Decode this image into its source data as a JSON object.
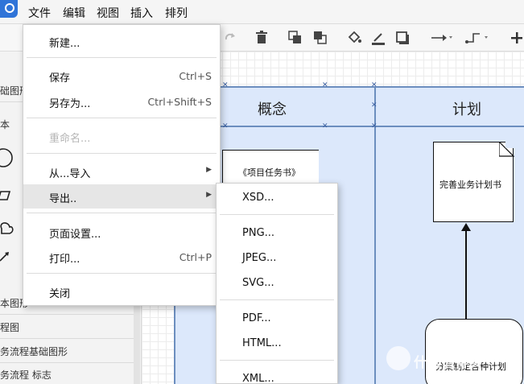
{
  "menubar": {
    "items": [
      "文件",
      "编辑",
      "视图",
      "插入",
      "排列"
    ]
  },
  "sidebar": {
    "labels": {
      "basic_fragment": "础图形",
      "text_fragment": "本",
      "basic_shapes": "本图形",
      "flowchart": "程图",
      "bpmn_basic": "务流程基础图形",
      "bpmn_marks": "务流程 标志"
    }
  },
  "canvas": {
    "lanes": [
      "概念",
      "计划"
    ],
    "doc_left": "《项目任务书》",
    "doc_right": "完善业务计划书",
    "doc_bottom": "分案制定各种计划"
  },
  "file_menu": {
    "items": [
      {
        "label": "新建...",
        "shortcut": ""
      },
      {
        "label": "保存",
        "shortcut": "Ctrl+S"
      },
      {
        "label": "另存为...",
        "shortcut": "Ctrl+Shift+S"
      },
      {
        "label": "重命名...",
        "shortcut": ""
      },
      {
        "label": "从...导入",
        "shortcut": ""
      },
      {
        "label": "导出..",
        "shortcut": ""
      },
      {
        "label": "页面设置...",
        "shortcut": ""
      },
      {
        "label": "打印...",
        "shortcut": "Ctrl+P"
      },
      {
        "label": "关闭",
        "shortcut": ""
      }
    ]
  },
  "export_menu": {
    "items": [
      "XSD...",
      "PNG...",
      "JPEG...",
      "SVG...",
      "PDF...",
      "HTML...",
      "XML..."
    ]
  },
  "colors": {
    "accent": "#2f74d8",
    "lane_fill": "#dce8fb",
    "lane_border": "#6c8ebf"
  },
  "watermark": "什么值得买"
}
